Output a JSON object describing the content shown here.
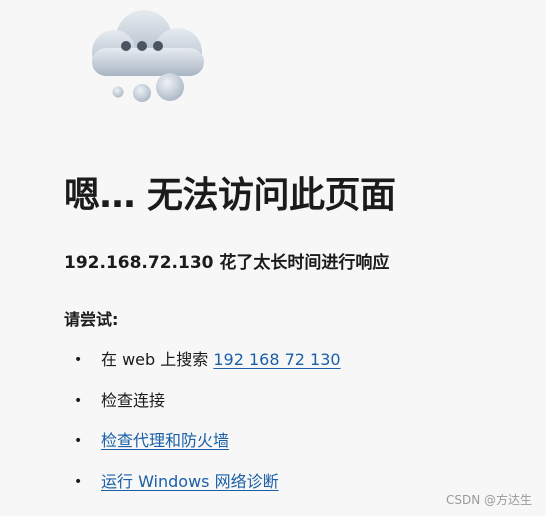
{
  "icon": "cloud-with-ellipsis-icon",
  "title": "嗯… 无法访问此页面",
  "subtitle": "192.168.72.130 花了太长时间进行响应",
  "try_label": "请尝试:",
  "suggestions": {
    "search": {
      "prefix": "在 web 上搜索 ",
      "link": "192 168 72 130"
    },
    "check_connection": {
      "text": "检查连接"
    },
    "check_proxy": {
      "link": "检查代理和防火墙"
    },
    "diagnostics": {
      "link": "运行 Windows 网络诊断"
    }
  },
  "bullet": "•",
  "watermark": "CSDN @方达生",
  "colors": {
    "background": "#f7f7f7",
    "text": "#1b1b1b",
    "link": "#1a5fa8"
  }
}
